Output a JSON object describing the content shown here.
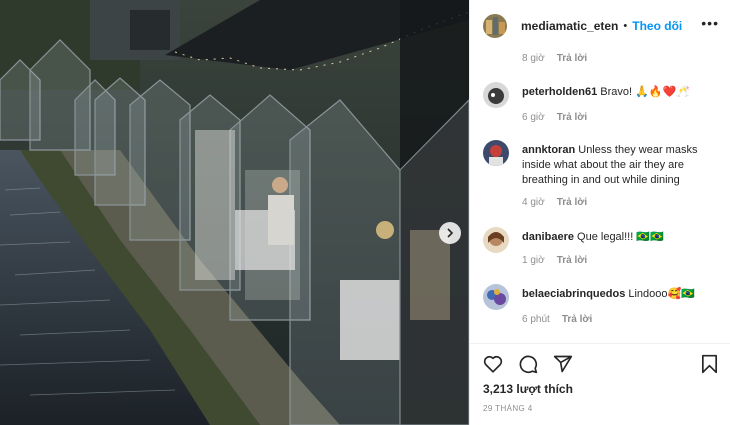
{
  "post": {
    "username": "mediamatic_eten",
    "follow_label": "Theo dõi",
    "more_icon": "more-horizontal-icon"
  },
  "first_meta": {
    "time": "8 giờ",
    "reply": "Trả lời"
  },
  "comments": [
    {
      "user": "peterholden61",
      "text": "Bravo! 🙏🔥❤️🥂",
      "time": "6 giờ",
      "reply": "Trả lời"
    },
    {
      "user": "annktoran",
      "text": "Unless they wear masks inside what about the air they are breathing in and out while dining",
      "time": "4 giờ",
      "reply": "Trả lời"
    },
    {
      "user": "danibaere",
      "text": "Que legal!!! 🇧🇷🇧🇷",
      "time": "1 giờ",
      "reply": "Trả lời"
    },
    {
      "user": "belaeciabrinquedos",
      "text": "Lindooo🥰🇧🇷",
      "time": "6 phút",
      "reply": "Trả lời"
    }
  ],
  "likes": "3,213 lượt thích",
  "date": "29 THÁNG 4",
  "icons": [
    "heart-icon",
    "comment-icon",
    "share-icon",
    "bookmark-icon",
    "chevron-right-icon"
  ]
}
